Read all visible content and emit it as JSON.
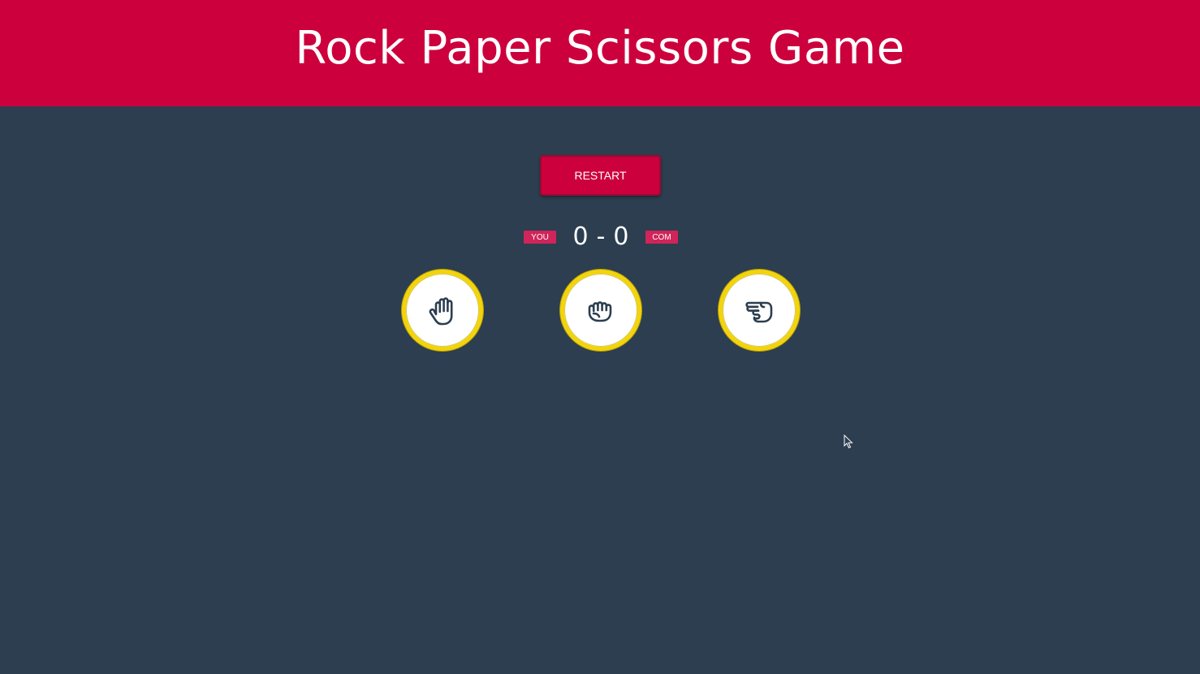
{
  "header": {
    "title": "Rock Paper Scissors Game"
  },
  "controls": {
    "restart_label": "RESTART"
  },
  "scoreboard": {
    "user_label": "YOU",
    "user_score": "0",
    "separator": "-",
    "computer_score": "0",
    "computer_label": "COM"
  },
  "choices": [
    {
      "name": "paper",
      "icon": "hand-open-icon"
    },
    {
      "name": "rock",
      "icon": "hand-fist-icon"
    },
    {
      "name": "scissors",
      "icon": "hand-point-icon"
    }
  ],
  "colors": {
    "background": "#2c3e50",
    "header": "#cc003c",
    "button": "#cc003c",
    "badge": "#d0245a",
    "choice_border": "#f2d40c",
    "choice_fill": "#ffffff",
    "icon_stroke": "#2c3e50"
  }
}
